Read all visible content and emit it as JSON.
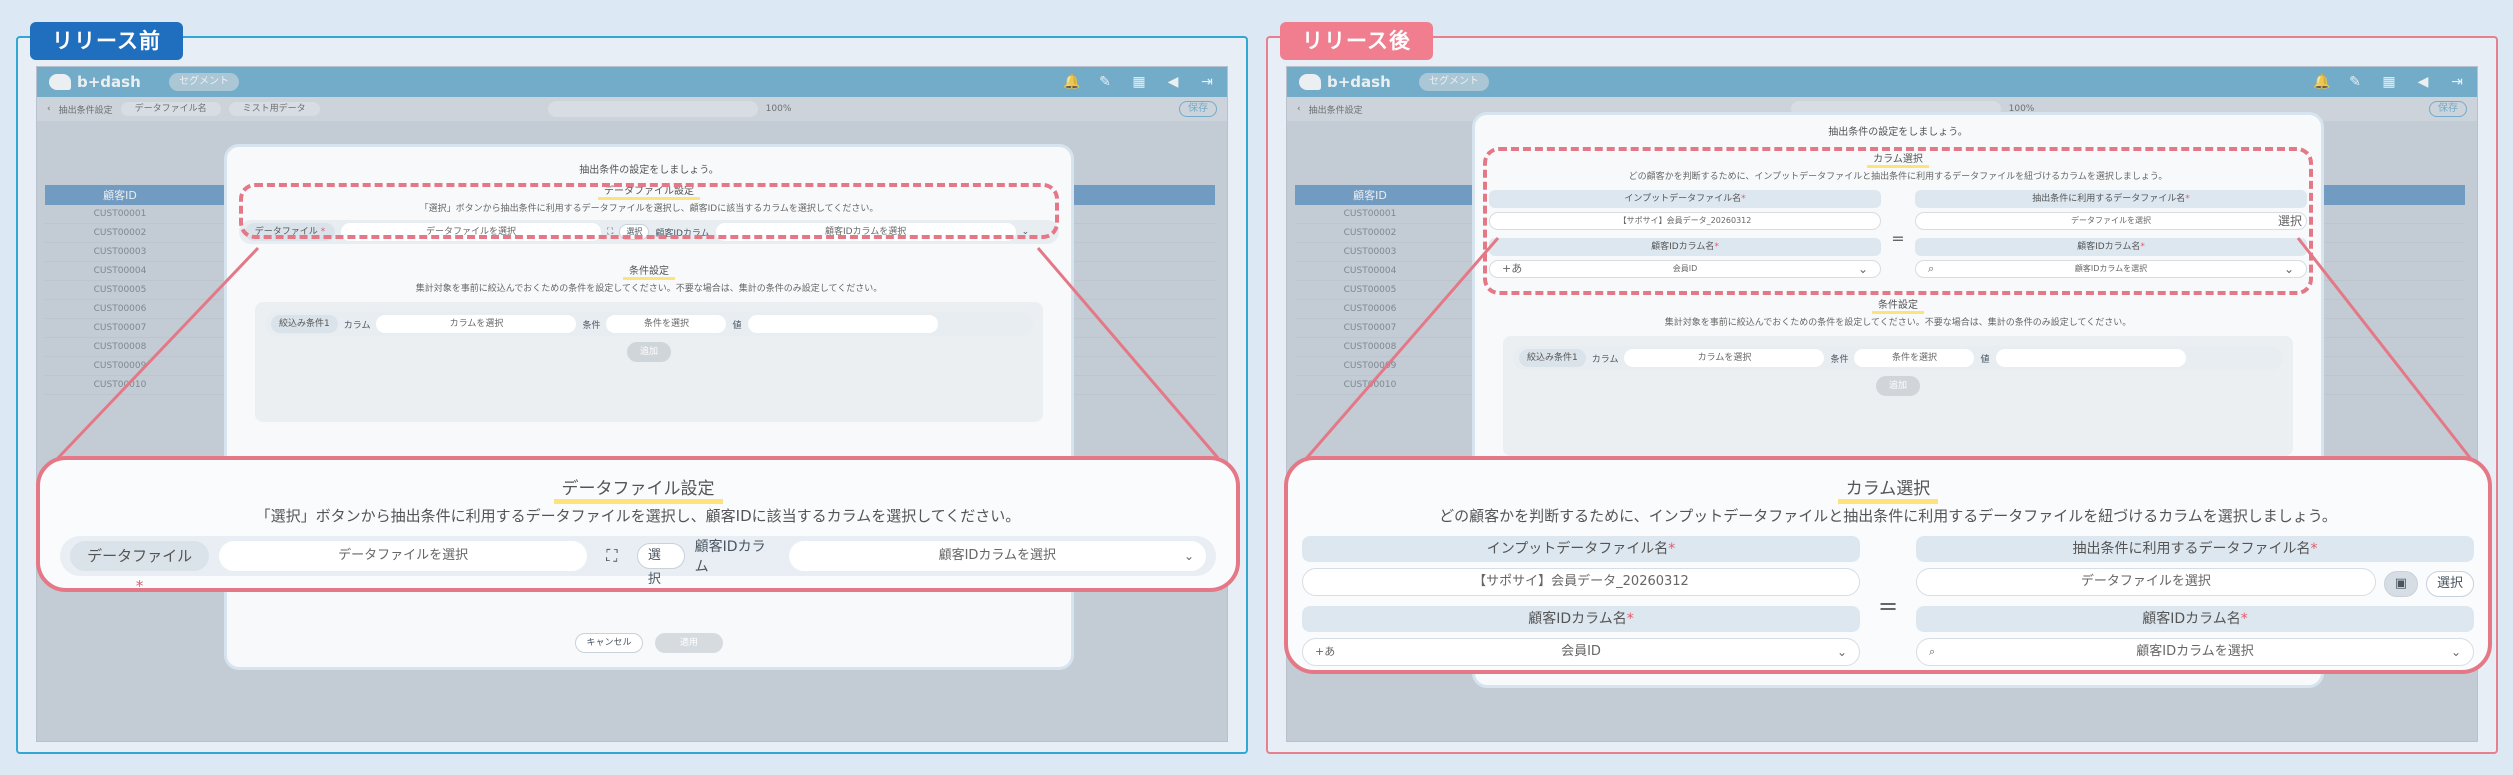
{
  "labels": {
    "before": "リリース前",
    "after": "リリース後"
  },
  "app": {
    "logo": "b+dash",
    "segment": "セグメント",
    "crumb_page": "抽出条件設定",
    "crumb_chip1": "データファイル名",
    "crumb_chip2": "ミスト用データ",
    "zoom": "100%",
    "save": "保存",
    "table_header": "顧客ID",
    "customer_ids": [
      "CUST00001",
      "CUST00002",
      "CUST00003",
      "CUST00004",
      "CUST00005",
      "CUST00006",
      "CUST00007",
      "CUST00008",
      "CUST00009",
      "CUST00010"
    ],
    "cancel": "キャンセル",
    "apply": "適用"
  },
  "modal": {
    "intro": "抽出条件の設定をしましょう。",
    "datafile_title": "データファイル設定",
    "datafile_desc": "「選択」ボタンから抽出条件に利用するデータファイルを選択し、顧客IDに該当するカラムを選択してください。",
    "datafile_label": "データファイル",
    "datafile_placeholder": "データファイルを選択",
    "select_btn": "選択",
    "customer_col_label": "顧客IDカラム",
    "customer_col_placeholder": "顧客IDカラムを選択",
    "cond_title": "条件設定",
    "cond_desc": "集計対象を事前に絞込んでおくための条件を設定してください。不要な場合は、集計の条件のみ設定してください。",
    "filter_label": "絞込み条件1",
    "column_label": "カラム",
    "column_placeholder": "カラムを選択",
    "condition_label": "条件",
    "condition_placeholder": "条件を選択",
    "value_label": "値",
    "add_btn": "追加"
  },
  "after_modal": {
    "colsel_title": "カラム選択",
    "colsel_desc": "どの顧客かを判断するために、インプットデータファイルと抽出条件に利用するデータファイルを紐づけるカラムを選択しましょう。",
    "input_file_label": "インプットデータファイル名",
    "input_file_value": "【サポサイ】会員データ_20260312",
    "extract_file_label": "抽出条件に利用するデータファイル名",
    "extract_file_placeholder": "データファイルを選択",
    "customer_col_name_label": "顧客IDカラム名",
    "input_col_value": "会員ID",
    "input_col_prefix": "+あ",
    "extract_col_placeholder": "顧客IDカラムを選択",
    "equals": "=",
    "required": "*"
  },
  "colors": {
    "before": "#1f6fbe",
    "after": "#f07e8f",
    "highlight": "#e57886"
  }
}
